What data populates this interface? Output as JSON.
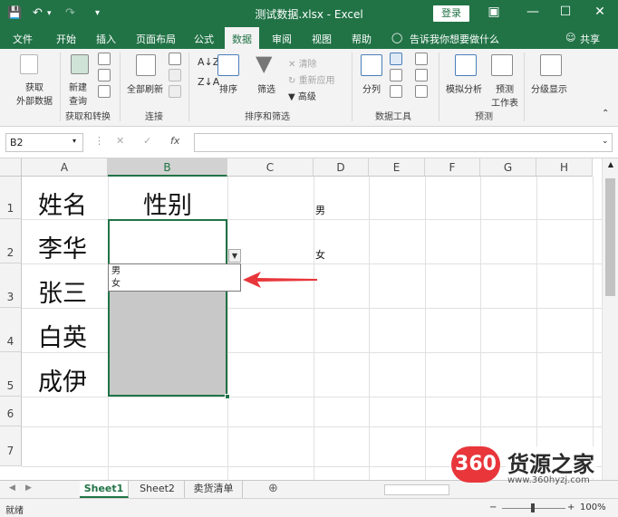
{
  "titlebar": {
    "title": "测试数据.xlsx  -  Excel",
    "login": "登录"
  },
  "tabs": [
    "文件",
    "开始",
    "插入",
    "页面布局",
    "公式",
    "数据",
    "审阅",
    "视图",
    "帮助"
  ],
  "active_tab": "数据",
  "tell_me": "告诉我你想要做什么",
  "share": "共享",
  "ribbon": {
    "get_external": [
      "获取",
      "外部数据"
    ],
    "new_query": [
      "新建",
      "查询"
    ],
    "group1_label": "获取和转换",
    "refresh_all": "全部刷新",
    "group2_label": "连接",
    "sort": "排序",
    "filter": "筛选",
    "clear": "清除",
    "reapply": "重新应用",
    "advanced": "高级",
    "group3_label": "排序和筛选",
    "split": "分列",
    "group4_label": "数据工具",
    "what_if": "模拟分析",
    "forecast": [
      "预测",
      "工作表"
    ],
    "group5_label": "预测",
    "outline": "分级显示"
  },
  "namebox": "B2",
  "columns": [
    "A",
    "B",
    "C",
    "D",
    "E",
    "F",
    "G",
    "H"
  ],
  "rows": [
    "1",
    "2",
    "3",
    "4",
    "5",
    "6",
    "7"
  ],
  "cells": {
    "A1": "姓名",
    "B1": "性别",
    "A2": "李华",
    "A3": "张三",
    "A4": "白英",
    "A5": "成伊",
    "D1": "男",
    "D2": "女"
  },
  "dropdown_options": [
    "男",
    "女"
  ],
  "sheets": [
    "Sheet1",
    "Sheet2",
    "卖货清单"
  ],
  "active_sheet": "Sheet1",
  "status": "就绪",
  "zoom": "100%",
  "watermark": {
    "logo": "360",
    "text": "货源之家",
    "url": "www.360hyzj.com"
  },
  "colors": {
    "excel_green": "#217346",
    "selection_gray": "#c8c8c8",
    "arrow_red": "#e8363b"
  }
}
